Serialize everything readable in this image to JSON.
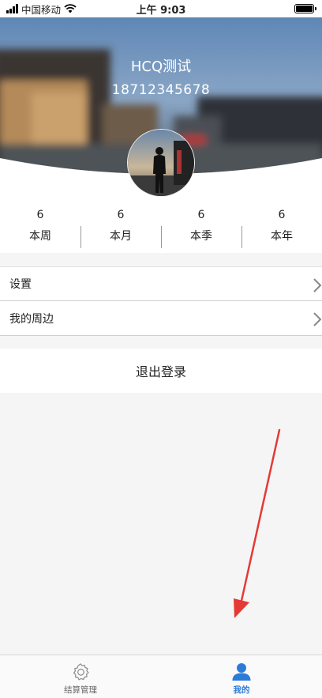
{
  "status_bar": {
    "carrier": "中国移动",
    "time": "上午 9:03"
  },
  "profile": {
    "name": "HCQ测试",
    "phone": "18712345678"
  },
  "stats": [
    {
      "value": "6",
      "label": "本周"
    },
    {
      "value": "6",
      "label": "本月"
    },
    {
      "value": "6",
      "label": "本季"
    },
    {
      "value": "6",
      "label": "本年"
    }
  ],
  "menu": [
    {
      "label": "设置"
    },
    {
      "label": "我的周边"
    }
  ],
  "logout_label": "退出登录",
  "tab_bar": [
    {
      "label": "结算管理",
      "icon": "gear-icon",
      "active": false
    },
    {
      "label": "我的",
      "icon": "user-icon",
      "active": true
    }
  ],
  "colors": {
    "accent": "#2d7bd8",
    "annotation_arrow": "#e53935"
  }
}
